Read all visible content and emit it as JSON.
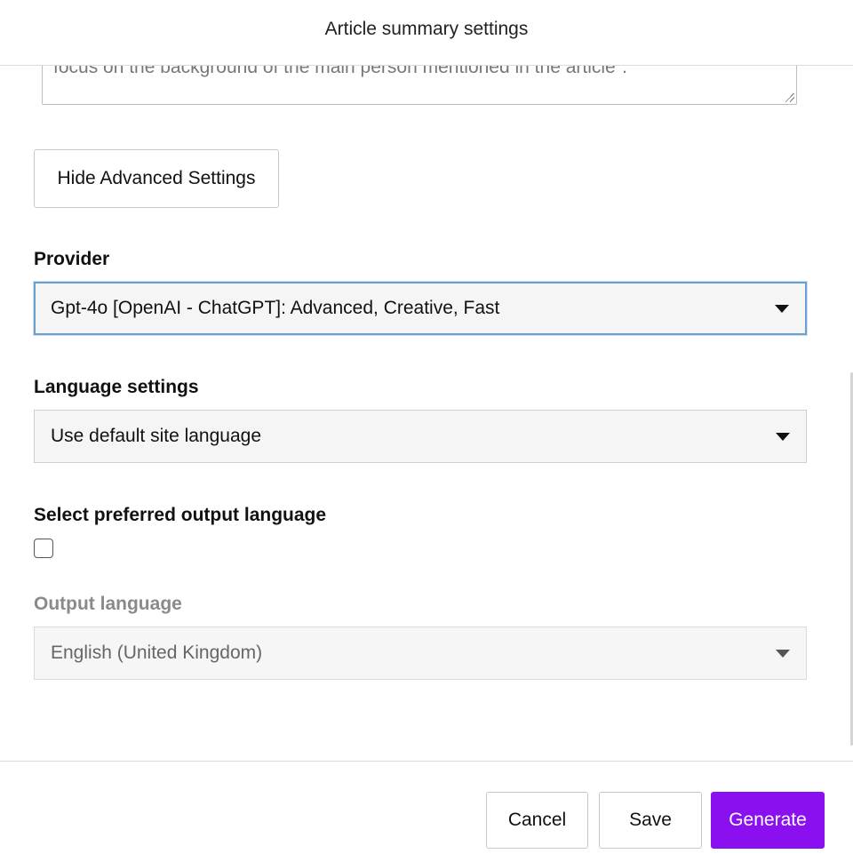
{
  "dialog": {
    "title": "Article summary settings"
  },
  "prompt": {
    "visible_text": "focus on the background of the main person mentioned in the article\"."
  },
  "advanced_toggle": {
    "label": "Hide Advanced Settings"
  },
  "provider": {
    "label": "Provider",
    "selected": "Gpt-4o [OpenAI - ChatGPT]: Advanced, Creative, Fast"
  },
  "language_settings": {
    "label": "Language settings",
    "selected": "Use default site language"
  },
  "preferred_output": {
    "label": "Select preferred output language",
    "checked": false
  },
  "output_language": {
    "label": "Output language",
    "selected": "English (United Kingdom)",
    "disabled": true
  },
  "footer": {
    "cancel_label": "Cancel",
    "save_label": "Save",
    "generate_label": "Generate"
  },
  "colors": {
    "primary": "#8b10f0",
    "focus_border": "#6a9fd0"
  },
  "icons": {
    "dropdown": "caret-down-icon",
    "resize": "resize-grip-icon"
  }
}
